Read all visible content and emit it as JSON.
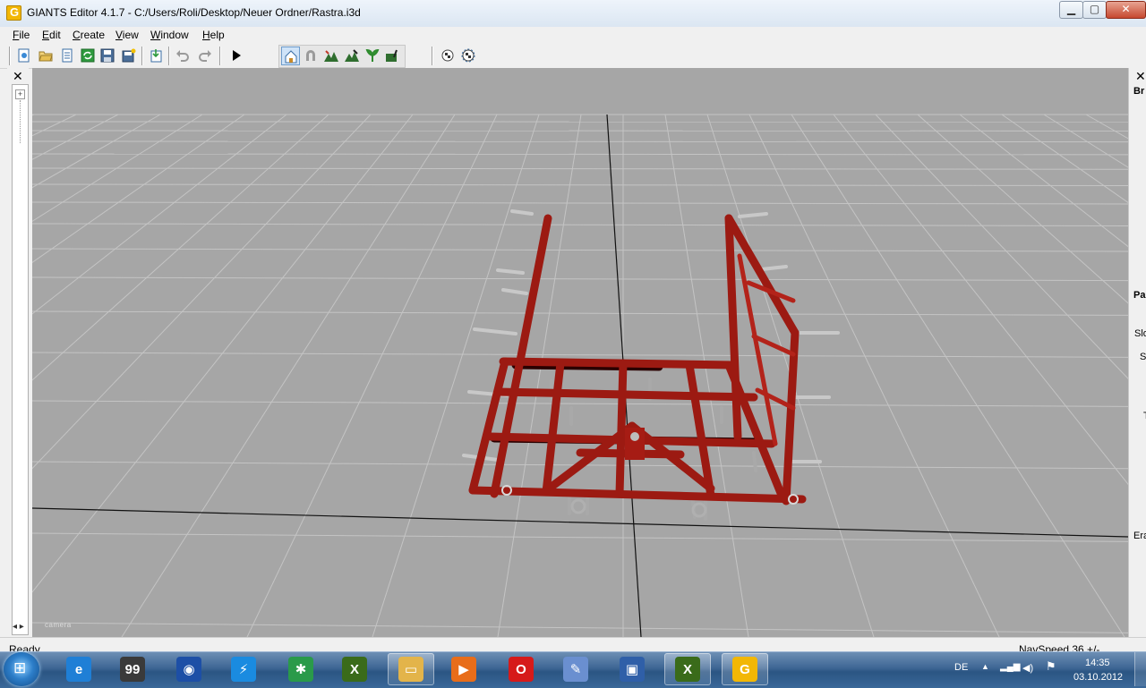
{
  "window": {
    "title": "GIANTS Editor 4.1.7 - C:/Users/Roli/Desktop/Neuer Ordner/Rastra.i3d",
    "app_icon": "giants-logo-icon",
    "app_icon_letter": "G",
    "minimize": "▁",
    "maximize": "▢",
    "close": "✕"
  },
  "menu": [
    {
      "label": "File",
      "underline": "F",
      "rest": "ile"
    },
    {
      "label": "Edit",
      "underline": "E",
      "rest": "dit"
    },
    {
      "label": "Create",
      "underline": "C",
      "rest": "reate"
    },
    {
      "label": "View",
      "underline": "V",
      "rest": "iew"
    },
    {
      "label": "Window",
      "underline": "W",
      "rest": "indow"
    },
    {
      "label": "Help",
      "underline": "H",
      "rest": "elp"
    }
  ],
  "toolbar": {
    "group1": [
      "new-icon",
      "open-icon",
      "properties-icon",
      "refresh-icon",
      "save-icon",
      "save-all-icon",
      "import-icon",
      "undo-icon",
      "redo-icon",
      "play-icon"
    ],
    "group2": [
      "home-camera-icon",
      "magnet-icon",
      "terrain-icon",
      "terrain-paint-icon",
      "foliage-icon",
      "foliage-paint-icon"
    ],
    "group3": [
      "checker-icon",
      "checker-select-icon"
    ]
  },
  "left_panel": {
    "close": "✕",
    "expand": "+",
    "scroll": "◂ ▸"
  },
  "viewport": {
    "camera_label": "camera"
  },
  "right_panel": {
    "close": "✕",
    "labels": [
      "Br",
      "Pa",
      "Slo",
      "S",
      "",
      "T",
      "Era"
    ]
  },
  "status": {
    "ready": "Ready",
    "navspeed": "NavSpeed 36 +/-"
  },
  "taskbar": {
    "start": "⊞",
    "apps": [
      {
        "name": "internet-explorer-icon",
        "glyph": "e",
        "color": "#1f7fd6"
      },
      {
        "name": "system-monitor-icon",
        "glyph": "99",
        "color": "#3a3a3a"
      },
      {
        "name": "browser-globe-icon",
        "glyph": "◉",
        "color": "#1d4fa6"
      },
      {
        "name": "lightning-app-icon",
        "glyph": "⚡",
        "color": "#1a8be0"
      },
      {
        "name": "tool-app-icon",
        "glyph": "✱",
        "color": "#2a9a4a"
      },
      {
        "name": "xnview-icon",
        "glyph": "X",
        "color": "#3a6b1a"
      },
      {
        "name": "file-explorer-icon",
        "glyph": "▭",
        "color": "#e3b44a"
      },
      {
        "name": "media-player-icon",
        "glyph": "▶",
        "color": "#e86d1a"
      },
      {
        "name": "opera-icon",
        "glyph": "O",
        "color": "#d61a1a"
      },
      {
        "name": "paint-icon",
        "glyph": "✎",
        "color": "#6a8fd0"
      },
      {
        "name": "remote-desktop-icon",
        "glyph": "▣",
        "color": "#2f5fa8"
      },
      {
        "name": "xnview-active-icon",
        "glyph": "X",
        "color": "#3a6b1a"
      },
      {
        "name": "giants-editor-icon",
        "glyph": "G",
        "color": "#f2b705"
      }
    ],
    "tray": {
      "language": "DE",
      "arrow": "▲",
      "signal": "▂▄▆",
      "volume": "◀)",
      "flag": "⚑"
    },
    "clock_time": "14:35",
    "clock_date": "03.10.2012"
  }
}
